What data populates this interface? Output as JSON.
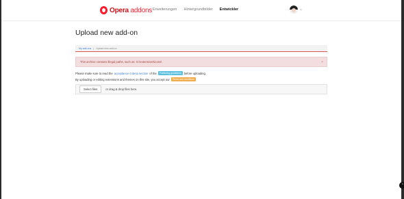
{
  "header": {
    "logo_brand": "Opera",
    "logo_sub": "addons",
    "nav": [
      "Erweiterungen",
      "Hintergrundbilder",
      "Entwickler"
    ]
  },
  "page": {
    "title": "Upload new add-on",
    "breadcrumb": [
      "My add-ons",
      "Upload new add-on"
    ],
    "alert": "This archive contains illegal paths, such as: G:\\extensions\\icons\\",
    "alert_close": "×",
    "line1_pre": "Please make sure to read the",
    "line1_link": "acceptance criteria section",
    "line1_mid": "of the",
    "line1_badge": "Publishing guidelines",
    "line1_post": "before uploading.",
    "line2_pre": "By uploading or editing extensions and themes on this site, you accept our",
    "line2_badge": "Terms and conditions",
    "select_files": "Select files",
    "drop_text": "or drag & drop files here."
  },
  "icons": {
    "chevron": "⌄",
    "side_button": "⌃"
  },
  "colors": {
    "brand_red": "#ff1b2d",
    "alert_bg": "#f2dede",
    "alert_text": "#a94442",
    "link": "#3b7dd8",
    "badge_blue": "#5bc0de",
    "badge_orange": "#f0ad4e"
  }
}
